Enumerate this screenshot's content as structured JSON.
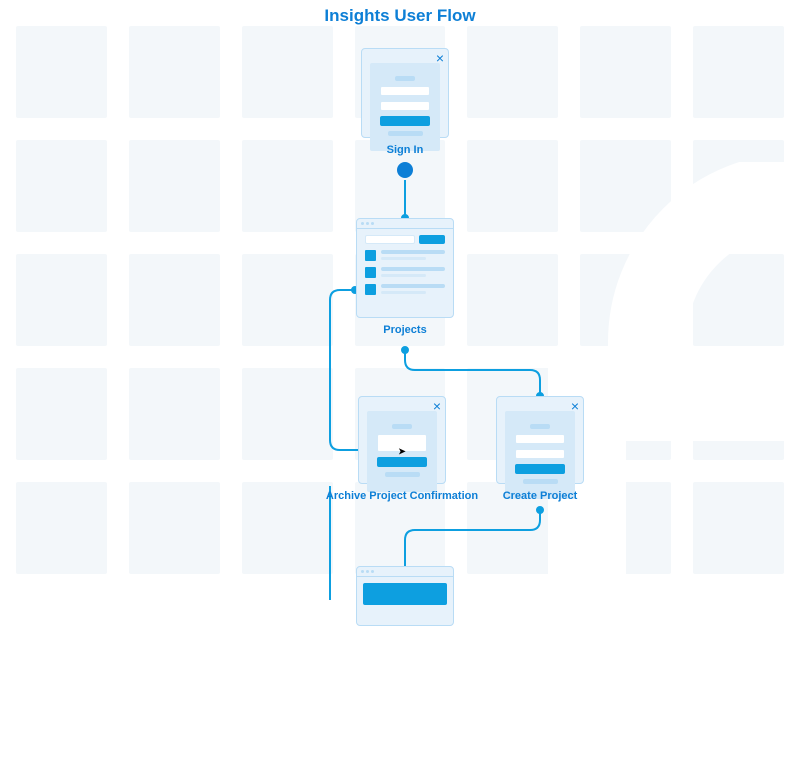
{
  "title": "Insights User Flow",
  "nodes": {
    "signin": {
      "label": "Sign In"
    },
    "projects": {
      "label": "Projects"
    },
    "archive": {
      "label": "Archive Project Confirmation"
    },
    "create": {
      "label": "Create Project"
    }
  },
  "colors": {
    "accent": "#0d7fd6",
    "primary": "#0d9fe0",
    "panel": "#e7f2fb"
  }
}
